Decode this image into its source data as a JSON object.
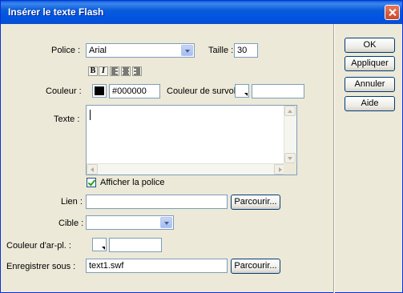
{
  "window": {
    "title": "Insérer le texte Flash",
    "close_icon": "close-icon"
  },
  "font": {
    "label": "Police :",
    "value": "Arial"
  },
  "size": {
    "label": "Taille :",
    "value": "30"
  },
  "format_buttons": {
    "bold": "B",
    "italic": "I",
    "align_left_icon": "align-left-icon",
    "align_center_icon": "align-center-icon",
    "align_right_icon": "align-right-icon"
  },
  "color": {
    "label": "Couleur :",
    "value": "#000000",
    "swatch_color": "#000000"
  },
  "hover_color": {
    "label": "Couleur de survol :",
    "value": ""
  },
  "text": {
    "label": "Texte :",
    "value": ""
  },
  "show_font": {
    "label": "Afficher la police",
    "checked": true
  },
  "link": {
    "label": "Lien :",
    "value": "",
    "browse_label": "Parcourir..."
  },
  "target": {
    "label": "Cible :",
    "value": ""
  },
  "bg_color": {
    "label": "Couleur d'ar-pl. :",
    "value": ""
  },
  "save_as": {
    "label": "Enregistrer sous :",
    "value": "text1.swf",
    "browse_label": "Parcourir..."
  },
  "buttons": {
    "ok": "OK",
    "apply": "Appliquer",
    "cancel": "Annuler",
    "help": "Aide"
  },
  "colors": {
    "titlebar": "#0054e3",
    "dialog_bg": "#ece9d8",
    "input_border": "#7f9db9"
  }
}
